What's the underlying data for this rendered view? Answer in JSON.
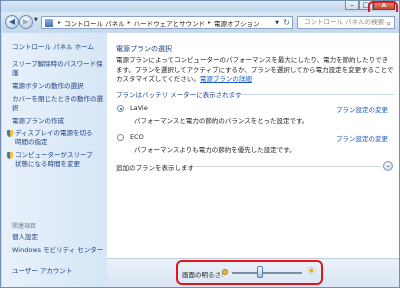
{
  "window": {
    "minimize_glyph": "–",
    "maximize_glyph": "□",
    "close_glyph": "X"
  },
  "nav": {
    "back_glyph": "◀",
    "forward_glyph": "▶",
    "dropdown_glyph": "▼",
    "refresh_glyph": "↻"
  },
  "address": {
    "separator": "▸",
    "crumbs": [
      "コントロール パネル",
      "ハードウェアとサウンド",
      "電源オプション"
    ],
    "dropdown_glyph": "▼"
  },
  "search": {
    "placeholder": "コントロール パネルの検索",
    "icon": "search-icon",
    "icon_glyph": "⌕"
  },
  "sidebar": {
    "home": "コントロール パネル ホーム",
    "items": [
      "スリープ解除時のパスワード保護",
      "電源ボタンの動作の選択",
      "カバーを閉じたときの動作の選択",
      "電源プランの作成",
      "ディスプレイの電源を切る時間の指定",
      "コンピューターがスリープ状態になる時間を変更"
    ],
    "related_header": "関連項目",
    "related": [
      "個人設定",
      "Windows モビリティ センター",
      "ユーザー アカウント"
    ]
  },
  "main": {
    "title": "電源プランの選択",
    "description": "電源プランによってコンピューターのパフォーマンスを最大にしたり、電力を節約したりできます。プランを選択してアクティブにするか、プランを選択してから電力設定を変更することでカスタマイズしてください。",
    "description_link": "電源プランの詳細",
    "battery_header": "プランはバッテリ メーターに表示されます",
    "plans": [
      {
        "name": "LaVie",
        "desc": "パフォーマンスと電力の節約のバランスをとった設定です。",
        "link": "プラン設定の変更",
        "selected": true
      },
      {
        "name": "ECO",
        "desc": "パフォーマンスよりも電力の節約を優先した設定です。",
        "link": "プラン設定の変更",
        "selected": false
      }
    ],
    "additional_plans": "追加のプランを表示します",
    "expand_glyph": "⌄"
  },
  "brightness": {
    "label": "画面の明るさ:",
    "level_fraction": 0.4,
    "big_sun_glyph": "☀"
  },
  "colors": {
    "accent_link": "#1c58c0",
    "highlight_red": "#e3141b",
    "sidebar_bg": "#d6e6f6"
  }
}
